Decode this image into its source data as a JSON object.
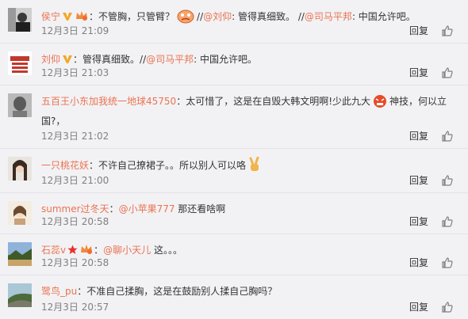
{
  "reply_label": "回复",
  "colors": {
    "name": "#eb7350",
    "meta": "#808080",
    "bg": "#f2f2f5"
  },
  "comments": [
    {
      "name": "侯宁",
      "sep": "：",
      "text_a": "不管胸，只管臂？",
      "text_b": "//",
      "mention_1": "@刘仰",
      "text_c": ": 管得真细致。 //",
      "mention_2": "@司马平邦",
      "text_d": ": 中国允许吧。",
      "time": "12月3日 21:09"
    },
    {
      "name": "刘仰",
      "sep": "：",
      "text_a": "管得真细致。//",
      "mention_1": "@司马平邦",
      "text_b": ": 中国允许吧。",
      "time": "12月3日 21:03"
    },
    {
      "name": "五百王小东加我统一地球45750",
      "sep": "：",
      "text_a": "太可惜了，这是在自毁大韩文明啊!少此九大",
      "text_b": "神技，何以立国?，",
      "time": "12月3日 21:02"
    },
    {
      "name": "一只桃花妖",
      "sep": "：",
      "text_a": "不许自己撩裙子。。所以别人可以咯",
      "time": "12月3日 21:00"
    },
    {
      "name": "summer过冬天",
      "sep": "：",
      "mention_1": "@小苹果777",
      "text_a": " 那还看啥啊",
      "time": "12月3日 20:58"
    },
    {
      "name": "石蕊v",
      "sep": "：",
      "mention_1": "@聊小天儿",
      "text_a": " 这。。。",
      "time": "12月3日 20:58"
    },
    {
      "name": "鹭鸟_pu",
      "sep": "：",
      "text_a": "不准自己揉胸，这是在鼓励别人揉自己胸吗？",
      "time": "12月3日 20:57"
    }
  ]
}
